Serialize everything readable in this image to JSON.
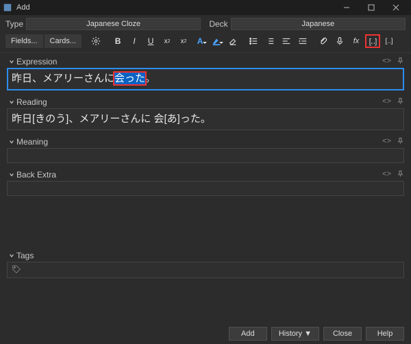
{
  "window": {
    "title": "Add"
  },
  "top": {
    "type_label": "Type",
    "type_value": "Japanese Cloze",
    "deck_label": "Deck",
    "deck_value": "Japanese"
  },
  "toolbar": {
    "fields": "Fields...",
    "cards": "Cards..."
  },
  "fields": {
    "expression": {
      "label": "Expression",
      "text_before": "昨日、メアリーさんに",
      "text_selected": "会った",
      "text_after": "。"
    },
    "reading": {
      "label": "Reading",
      "text": "昨日[きのう]、メアリーさんに 会[あ]った。"
    },
    "meaning": {
      "label": "Meaning",
      "text": ""
    },
    "backextra": {
      "label": "Back Extra",
      "text": ""
    }
  },
  "tags": {
    "label": "Tags"
  },
  "buttons": {
    "add": "Add",
    "history": "History ▼",
    "close": "Close",
    "help": "Help"
  },
  "field_acts": {
    "code": "<>",
    "pin": "📌"
  }
}
